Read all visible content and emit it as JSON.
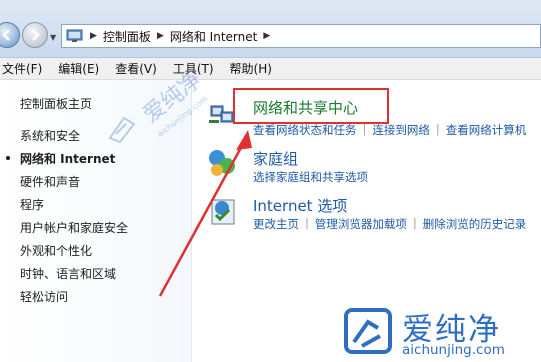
{
  "address_bar": {
    "breadcrumbs": [
      "控制面板",
      "网络和 Internet"
    ]
  },
  "menu": [
    "文件(F)",
    "编辑(E)",
    "查看(V)",
    "工具(T)",
    "帮助(H)"
  ],
  "sidebar": {
    "home": "控制面板主页",
    "items": [
      {
        "label": "系统和安全",
        "active": false
      },
      {
        "label": "网络和 Internet",
        "active": true
      },
      {
        "label": "硬件和声音",
        "active": false
      },
      {
        "label": "程序",
        "active": false
      },
      {
        "label": "用户帐户和家庭安全",
        "active": false
      },
      {
        "label": "外观和个性化",
        "active": false
      },
      {
        "label": "时钟、语言和区域",
        "active": false
      },
      {
        "label": "轻松访问",
        "active": false
      }
    ]
  },
  "main": {
    "categories": [
      {
        "title": "网络和共享中心",
        "icon": "network-center-icon",
        "links": [
          "查看网络状态和任务",
          "连接到网络",
          "查看网络计算机"
        ]
      },
      {
        "title": "家庭组",
        "icon": "homegroup-icon",
        "links": [
          "选择家庭组和共享选项"
        ]
      },
      {
        "title": "Internet 选项",
        "icon": "internet-options-icon",
        "links": [
          "更改主页",
          "管理浏览器加载项",
          "删除浏览的历史记录"
        ]
      }
    ]
  },
  "watermark": {
    "name": "爱纯净",
    "url": "aichunjing.com"
  },
  "colors": {
    "link": "#1e5aa8",
    "highlight": "#e03030",
    "arrow": "#e03030"
  }
}
